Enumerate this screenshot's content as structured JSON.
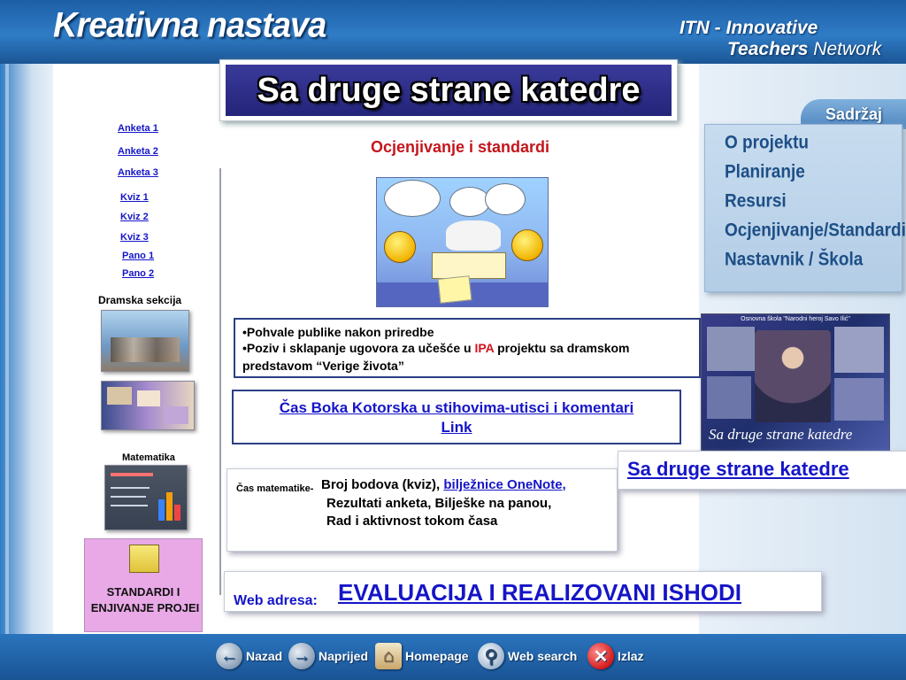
{
  "header": {
    "left_title": "Kreativna nastava",
    "right_line1": "ITN - Innovative",
    "right_line2_bold": "Teachers",
    "right_line2_rest": " Network"
  },
  "title": "Sa druge strane katedre",
  "section_title": "Ocjenjivanje i standardi",
  "left_links": [
    "Anketa 1",
    "Anketa 2",
    "Anketa 3",
    "Kviz 1",
    "Kviz 2",
    "Kviz 3",
    "Pano 1",
    "Pano 2"
  ],
  "labels": {
    "dramska": "Dramska sekcija",
    "matematika": "Matematika"
  },
  "standardi": {
    "line1": "STANDARDI I",
    "line2": "ENJIVANJE PROJEI"
  },
  "pohvale": {
    "line1": "•Pohvale publike nakon priredbe",
    "line2_a": "•Poziv  i sklapanje ugovora za učešće u ",
    "line2_ipa": "IPA",
    "line2_b": " projektu sa dramskom",
    "line3": "predstavom  “Verige života”"
  },
  "cas_link": {
    "line1": "Čas Boka Kotorska u stihovima-utisci i komentari",
    "line2": "Link"
  },
  "matematika": {
    "prefix": "Čas matematike-",
    "l1_text": " Broj bodova (kviz), ",
    "l1_link": "bilježnice OneNote,",
    "l2": "Rezultati anketa, Bilješke na panou,",
    "l3": "Rad i aktivnost tokom časa"
  },
  "web": {
    "label": "Web adresa: ",
    "link": "EVALUACIJA  I  REALIZOVANI  ISHODI "
  },
  "sadrzaj": {
    "tab": "Sadržaj",
    "items": [
      "O  projektu",
      "Planiranje",
      "Resursi",
      "Ocjenjivanje/Standardi",
      "Nastavnik / Škola"
    ]
  },
  "photo": {
    "top": "Osnovna škola \"Narodni heroj Savo Ilić\"",
    "caption": "Sa druge strane katedre"
  },
  "sadruge_link": "Sa druge strane katedre",
  "footer": {
    "back": "Nazad",
    "forward": "Naprijed",
    "home": "Homepage",
    "search": "Web search",
    "exit": "Izlaz"
  },
  "colors": {
    "header_blue": "#2f7cc6",
    "link_blue": "#1515c8",
    "title_red": "#c4151c",
    "banner_navy": "#2c2c88"
  }
}
